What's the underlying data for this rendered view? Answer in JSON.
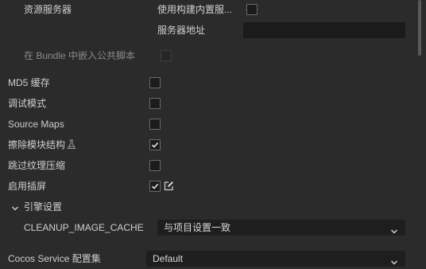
{
  "bundle_settings": {
    "resource_server_label": "资源服务器",
    "use_builtin_server_label": "使用构建内置服...",
    "use_builtin_server_checked": false,
    "server_address_label": "服务器地址",
    "server_address_value": "",
    "embed_common_script_label": "在 Bundle 中嵌入公共脚本",
    "embed_common_script_checked": false
  },
  "options": [
    {
      "label": "MD5 缓存",
      "checked": false
    },
    {
      "label": "调试模式",
      "checked": false
    },
    {
      "label": "Source Maps",
      "checked": false
    },
    {
      "label": "擦除模块结构",
      "checked": true,
      "icon": "flask-icon"
    },
    {
      "label": "跳过纹理压缩",
      "checked": false
    },
    {
      "label": "启用插屏",
      "checked": true,
      "edit_icon": "edit-icon"
    }
  ],
  "engine_settings": {
    "section_label": "引擎设置",
    "expanded": true,
    "cleanup_label": "CLEANUP_IMAGE_CACHE",
    "cleanup_value": "与项目设置一致"
  },
  "cocos_service": {
    "label": "Cocos Service 配置集",
    "value": "Default"
  },
  "colors": {
    "background": "#2b2b2b",
    "field_background": "#1b1b1b",
    "text": "#cfcfcf",
    "disabled_text": "#8a8a8a"
  }
}
